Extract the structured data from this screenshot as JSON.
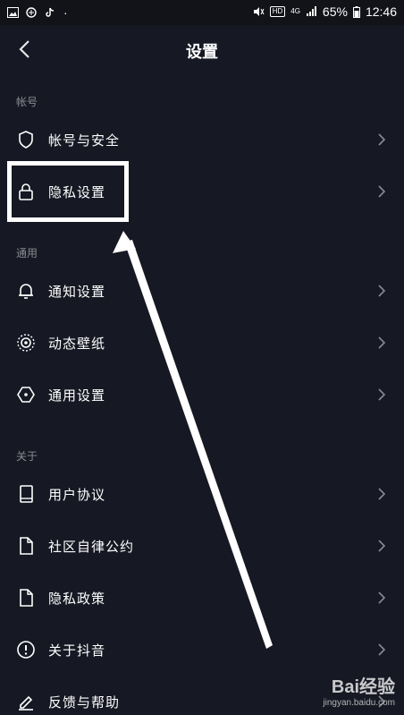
{
  "status_bar": {
    "network": "4G",
    "hd": "HD",
    "battery": "65%",
    "time": "12:46"
  },
  "header": {
    "title": "设置"
  },
  "sections": [
    {
      "label": "帐号"
    },
    {
      "label": "通用"
    },
    {
      "label": "关于"
    }
  ],
  "items": [
    {
      "label": "帐号与安全",
      "icon": "shield-icon"
    },
    {
      "label": "隐私设置",
      "icon": "lock-icon"
    },
    {
      "label": "通知设置",
      "icon": "bell-icon"
    },
    {
      "label": "动态壁纸",
      "icon": "wallpaper-icon"
    },
    {
      "label": "通用设置",
      "icon": "hexagon-icon"
    },
    {
      "label": "用户协议",
      "icon": "book-icon"
    },
    {
      "label": "社区自律公约",
      "icon": "document-icon"
    },
    {
      "label": "隐私政策",
      "icon": "document-icon"
    },
    {
      "label": "关于抖音",
      "icon": "info-icon"
    },
    {
      "label": "反馈与帮助",
      "icon": "pencil-icon"
    }
  ],
  "watermark": {
    "logo": "Bai经验",
    "url": "jingyan.baidu.com"
  },
  "colors": {
    "background": "#161823",
    "text": "#ffffff",
    "muted": "#8a8b91"
  }
}
